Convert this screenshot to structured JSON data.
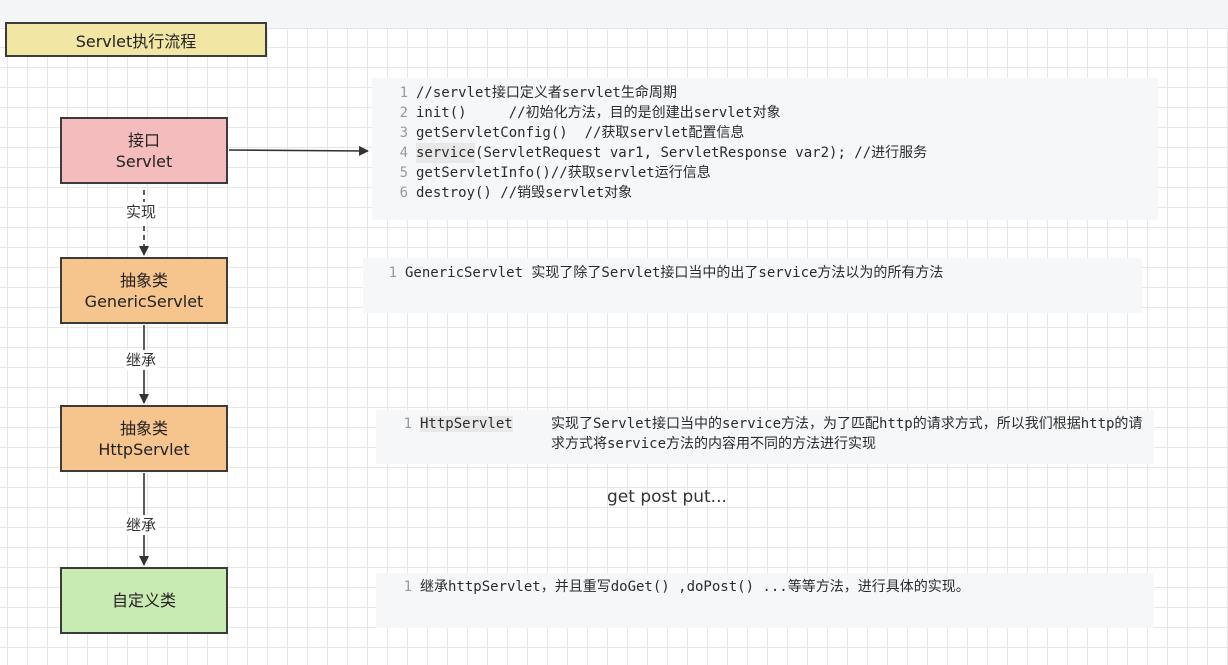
{
  "title": "Servlet执行流程",
  "nodes": {
    "servlet_interface": {
      "line1": "接口",
      "line2": "Servlet"
    },
    "generic_servlet": {
      "line1": "抽象类",
      "line2": "GenericServlet"
    },
    "http_servlet": {
      "line1": "抽象类",
      "line2": "HttpServlet"
    },
    "custom_class": {
      "line1": "自定义类"
    }
  },
  "edges": {
    "implements_label": "实现",
    "extends_label_1": "继承",
    "extends_label_2": "继承"
  },
  "code_blocks": {
    "servlet_methods": [
      {
        "num": "1",
        "text": "//servlet接口定义者servlet生命周期"
      },
      {
        "num": "2",
        "text": "init()     //初始化方法，目的是创建出servlet对象"
      },
      {
        "num": "3",
        "text": "getServletConfig()  //获取servlet配置信息"
      },
      {
        "num": "4",
        "keyword": "service",
        "text": "(ServletRequest var1, ServletResponse var2); //进行服务"
      },
      {
        "num": "5",
        "text": "getServletInfo()//获取servlet运行信息"
      },
      {
        "num": "6",
        "text": "destroy() //销毁servlet对象"
      }
    ],
    "generic_servlet_note": {
      "num": "1",
      "text": "GenericServlet 实现了除了Servlet接口当中的出了service方法以为的所有方法"
    },
    "http_servlet_note": {
      "num": "1",
      "tag": "HttpServlet",
      "text": "实现了Servlet接口当中的service方法，为了匹配http的请求方式，所以我们根据http的请求方式将service方法的内容用不同的方法进行实现"
    },
    "custom_class_note": {
      "num": "1",
      "text": "继承httpServlet，并且重写doGet() ,doPost() ...等等方法，进行具体的实现。"
    }
  },
  "free_text": "get post put..."
}
